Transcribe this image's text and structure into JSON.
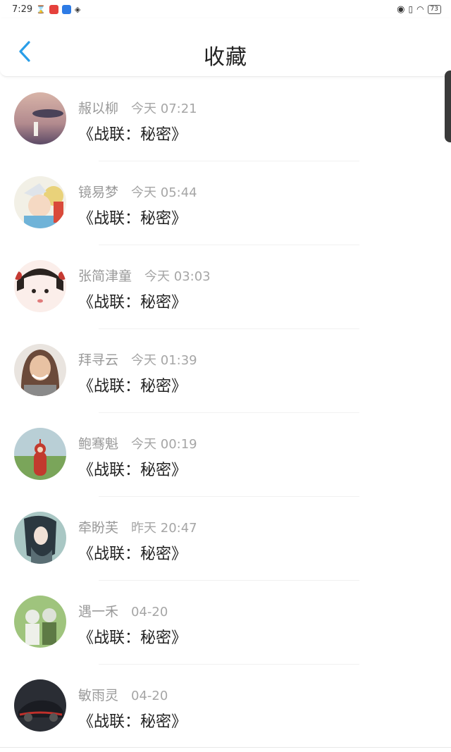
{
  "status_bar": {
    "time": "7:29",
    "battery": "73"
  },
  "header": {
    "title": "收藏"
  },
  "items": [
    {
      "name": "赧以柳",
      "time": "今天 07:21",
      "title": "《战联：秘密》",
      "avatar_colors": [
        "#b28a8e",
        "#5c4a66"
      ]
    },
    {
      "name": "镜易梦",
      "time": "今天 05:44",
      "title": "《战联：秘密》",
      "avatar_colors": [
        "#e9d27a",
        "#6fb3d8"
      ]
    },
    {
      "name": "张简津童",
      "time": "今天 03:03",
      "title": "《战联：秘密》",
      "avatar_colors": [
        "#f3d6cf",
        "#2a2320"
      ]
    },
    {
      "name": "拜寻云",
      "time": "今天 01:39",
      "title": "《战联：秘密》",
      "avatar_colors": [
        "#c9a58a",
        "#6b4a3a"
      ]
    },
    {
      "name": "鲍骞魁",
      "time": "今天 00:19",
      "title": "《战联：秘密》",
      "avatar_colors": [
        "#a7c98a",
        "#c23a2e"
      ]
    },
    {
      "name": "牵盼芙",
      "time": "昨天 20:47",
      "title": "《战联：秘密》",
      "avatar_colors": [
        "#7fa9a3",
        "#2b3840"
      ]
    },
    {
      "name": "遇一禾",
      "time": "04-20",
      "title": "《战联：秘密》",
      "avatar_colors": [
        "#9fc47d",
        "#e9ece6"
      ]
    },
    {
      "name": "敏雨灵",
      "time": "04-20",
      "title": "《战联：秘密》",
      "avatar_colors": [
        "#2a2d34",
        "#c0302b"
      ]
    }
  ],
  "colors": {
    "accent": "#2a9ee8"
  }
}
